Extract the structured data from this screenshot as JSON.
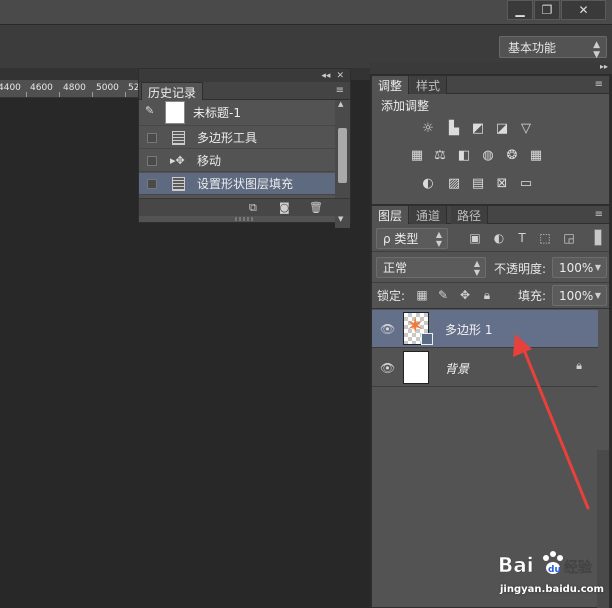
{
  "window": {
    "minimize": "▁",
    "restore": "❐",
    "close": "✕"
  },
  "workspace": {
    "label": "基本功能"
  },
  "ruler": {
    "ticks": [
      "4400",
      "4600",
      "4800",
      "5000",
      "52"
    ]
  },
  "history": {
    "collapse": "◂◂",
    "close": "✕",
    "tab": "历史记录",
    "menu": "≡",
    "snapshot_label": "未标题-1",
    "items": [
      {
        "label": "多边形工具",
        "icon": "document-icon"
      },
      {
        "label": "移动",
        "icon": "move-tool-icon"
      },
      {
        "label": "设置形状图层填充",
        "icon": "document-icon"
      }
    ]
  },
  "adjustments": {
    "tabs": [
      "调整",
      "样式"
    ],
    "menu": "≡",
    "add_label": "添加调整",
    "icons_row1": [
      "brightness-icon",
      "levels-icon",
      "curves-icon",
      "exposure-icon",
      "vibrance-icon"
    ],
    "icons_row2": [
      "hue-saturation-icon",
      "color-balance-icon",
      "black-white-icon",
      "photo-filter-icon",
      "channel-mixer-icon",
      "color-lookup-icon"
    ],
    "icons_row3": [
      "invert-icon",
      "posterize-icon",
      "threshold-icon",
      "selective-color-icon",
      "gradient-map-icon"
    ]
  },
  "layers": {
    "tabs": [
      "图层",
      "通道",
      "路径"
    ],
    "menu": "≡",
    "filter_kind": "ρ 类型",
    "blend_mode": "正常",
    "opacity_label": "不透明度:",
    "opacity_value": "100%",
    "lock_label": "锁定:",
    "fill_label": "填充:",
    "fill_value": "100%",
    "items": [
      {
        "name": "多边形 1",
        "selected": true,
        "locked": false
      },
      {
        "name": "背景",
        "selected": false,
        "locked": true
      }
    ]
  },
  "colors": {
    "selection": "#64708a",
    "arrow": "#e8403a",
    "shape": "#f07a3a"
  },
  "watermark": {
    "url": "jingyan.baidu.com"
  }
}
